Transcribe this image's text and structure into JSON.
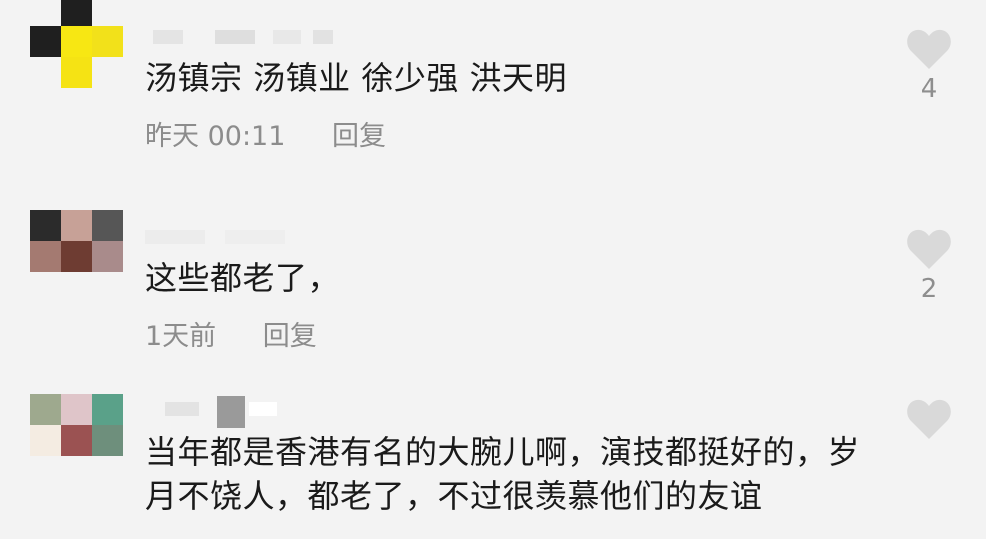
{
  "colors": {
    "background": "#f3f3f3",
    "text": "#1a1a1a",
    "meta_text": "#8c8c8c",
    "heart": "#d9d9d9"
  },
  "comments": [
    {
      "text": "汤镇宗 汤镇业 徐少强 洪天明",
      "time": "昨天 00:11",
      "reply_label": "回复",
      "likes": "4",
      "like_icon": "heart-icon",
      "avatar_pixels": [
        "#1f1f1f",
        "#f7e713",
        "#f3f3f3",
        "#1f1f1f",
        "#f7e713",
        "#f2e11a",
        "#f3f3f3",
        "#f5e314",
        "#f3f3f3"
      ]
    },
    {
      "text": "这些都老了，",
      "time": "1天前",
      "reply_label": "回复",
      "likes": "2",
      "like_icon": "heart-icon",
      "avatar_pixels": [
        "#2b2b2b",
        "#c7a197",
        "#565656",
        "#a47a71",
        "#6e3c32",
        "#a98b8b",
        "#f3f3f3",
        "#f3f3f3",
        "#f3f3f3"
      ]
    },
    {
      "text": "当年都是香港有名的大腕儿啊，演技都挺好的，岁月不饶人，都老了，不过很羡慕他们的友谊",
      "time": "",
      "reply_label": "",
      "likes": "",
      "like_icon": "heart-icon",
      "avatar_pixels": [
        "#9ea98e",
        "#dfc5c9",
        "#5aa189",
        "#f4ece2",
        "#9b5252",
        "#6e8f7c",
        "#f3f3f3",
        "#f3f3f3",
        "#f3f3f3"
      ]
    }
  ]
}
